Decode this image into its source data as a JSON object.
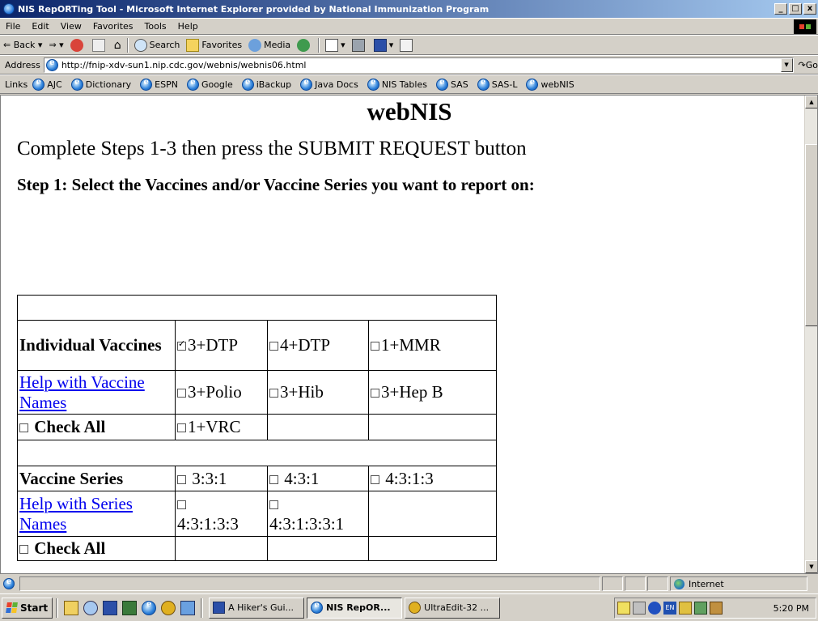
{
  "window": {
    "title": "NIS RepORTing Tool - Microsoft Internet Explorer provided by National Immunization Program",
    "controls": [
      "_",
      "□",
      "x"
    ]
  },
  "menu": [
    "File",
    "Edit",
    "View",
    "Favorites",
    "Tools",
    "Help"
  ],
  "toolbar": {
    "back": "Back",
    "search": "Search",
    "favorites": "Favorites",
    "media": "Media"
  },
  "address": {
    "label": "Address",
    "url": "http://fnip-xdv-sun1.nip.cdc.gov/webnis/webnis06.html",
    "go": "Go"
  },
  "links": {
    "label": "Links",
    "items": [
      "AJC",
      "Dictionary",
      "ESPN",
      "Google",
      "iBackup",
      "Java Docs",
      "NIS Tables",
      "SAS",
      "SAS-L",
      "webNIS"
    ]
  },
  "page": {
    "heading": "webNIS",
    "intro": "Complete Steps 1-3 then press the SUBMIT REQUEST button",
    "step1": "Step 1: Select the Vaccines and/or Vaccine Series you want to report on:",
    "individual": {
      "header": "Individual Vaccines",
      "help": "Help with Vaccine Names",
      "check_all": "Check All",
      "options": [
        {
          "label": "3+DTP",
          "checked": true
        },
        {
          "label": "4+DTP",
          "checked": false
        },
        {
          "label": "1+MMR",
          "checked": false
        },
        {
          "label": "3+Polio",
          "checked": false
        },
        {
          "label": "3+Hib",
          "checked": false
        },
        {
          "label": "3+Hep B",
          "checked": false
        },
        {
          "label": "1+VRC",
          "checked": false
        }
      ]
    },
    "series": {
      "header": "Vaccine Series",
      "help": "Help with Series Names",
      "check_all": "Check All",
      "options": [
        {
          "label": "3:3:1",
          "checked": false
        },
        {
          "label": "4:3:1",
          "checked": false
        },
        {
          "label": "4:3:1:3",
          "checked": false
        },
        {
          "label": "4:3:1:3:3",
          "checked": false
        },
        {
          "label": "4:3:1:3:3:1",
          "checked": false
        }
      ]
    }
  },
  "status": {
    "zone": "Internet"
  },
  "taskbar": {
    "start": "Start",
    "tasks": [
      {
        "label": "A Hiker's Gui...",
        "active": false
      },
      {
        "label": "NIS RepOR...",
        "active": true
      },
      {
        "label": "UltraEdit-32 ...",
        "active": false
      }
    ],
    "clock": "5:20 PM"
  }
}
